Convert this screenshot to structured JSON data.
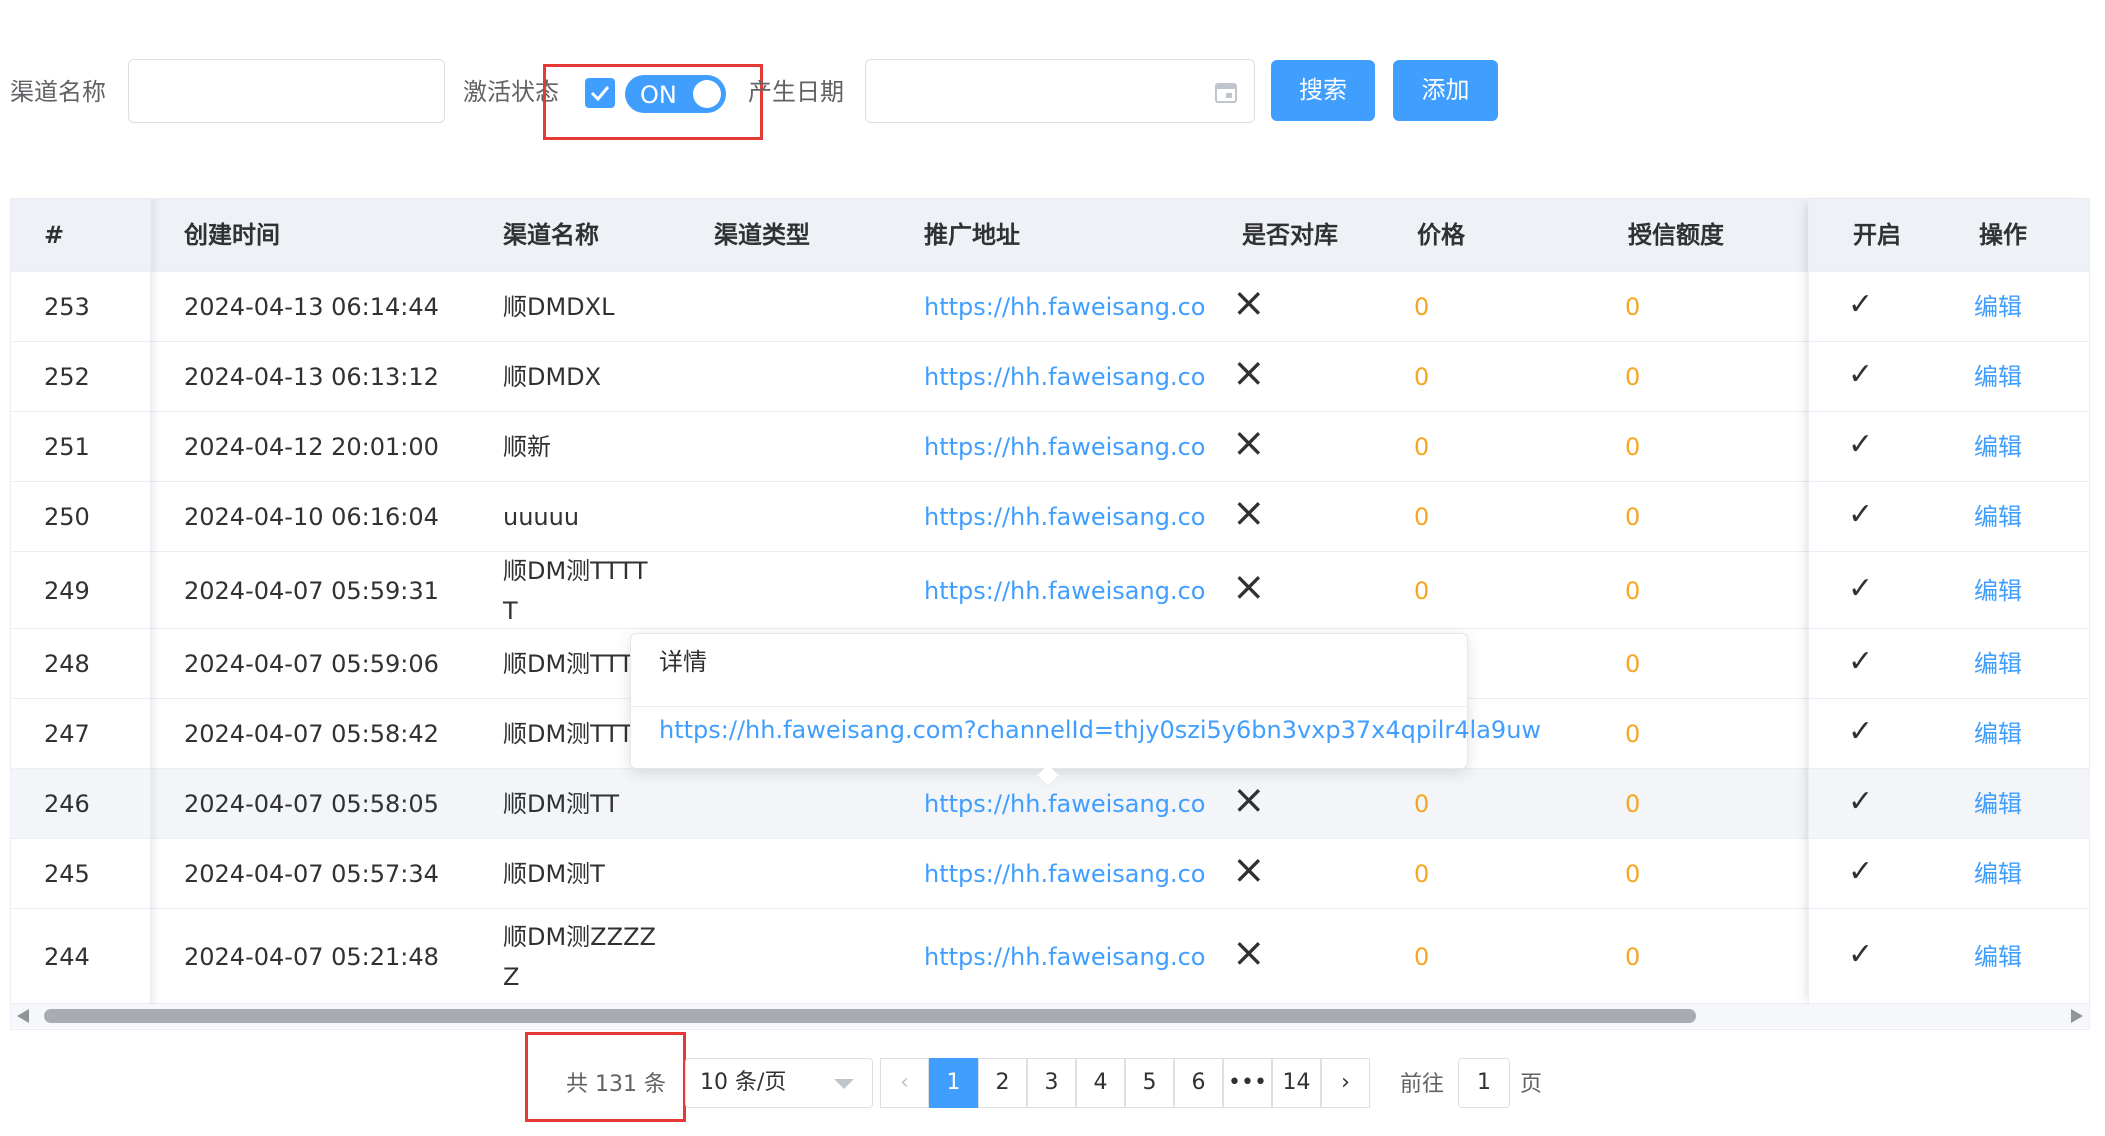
{
  "filters": {
    "channel_name_label": "渠道名称",
    "channel_name_value": "",
    "active_label": "激活状态",
    "active_checked": true,
    "switch_text": "ON",
    "date_label": "产生日期",
    "date_value": "",
    "calendar_icon": "calendar-icon",
    "search_label": "搜索",
    "add_label": "添加"
  },
  "table": {
    "headers": {
      "id": "#",
      "created": "创建时间",
      "name": "渠道名称",
      "type": "渠道类型",
      "url": "推广地址",
      "reconcile": "是否对库",
      "price": "价格",
      "credit": "授信额度",
      "enabled": "开启",
      "action": "操作"
    },
    "rows": [
      {
        "id": "253",
        "created": "2024-04-13 06:14:44",
        "name": "顺DMDXL",
        "name2": "",
        "type": "",
        "url": "https://hh.faweisang.co",
        "reconcile": "×",
        "price": "0",
        "credit": "0",
        "enabled": "✓",
        "action": "编辑"
      },
      {
        "id": "252",
        "created": "2024-04-13 06:13:12",
        "name": "顺DMDX",
        "name2": "",
        "type": "",
        "url": "https://hh.faweisang.co",
        "reconcile": "×",
        "price": "0",
        "credit": "0",
        "enabled": "✓",
        "action": "编辑"
      },
      {
        "id": "251",
        "created": "2024-04-12 20:01:00",
        "name": "顺新",
        "name2": "",
        "type": "",
        "url": "https://hh.faweisang.co",
        "reconcile": "×",
        "price": "0",
        "credit": "0",
        "enabled": "✓",
        "action": "编辑"
      },
      {
        "id": "250",
        "created": "2024-04-10 06:16:04",
        "name": "uuuuu",
        "name2": "",
        "type": "",
        "url": "https://hh.faweisang.co",
        "reconcile": "×",
        "price": "0",
        "credit": "0",
        "enabled": "✓",
        "action": "编辑"
      },
      {
        "id": "249",
        "created": "2024-04-07 05:59:31",
        "name": "顺DM测TTTT",
        "name2": "T",
        "type": "",
        "url": "https://hh.faweisang.co",
        "reconcile": "×",
        "price": "0",
        "credit": "0",
        "enabled": "✓",
        "action": "编辑"
      },
      {
        "id": "248",
        "created": "2024-04-07 05:59:06",
        "name": "顺DM测TTT",
        "name2": "",
        "type": "",
        "url": "",
        "reconcile": "",
        "price": "",
        "credit": "0",
        "enabled": "✓",
        "action": "编辑"
      },
      {
        "id": "247",
        "created": "2024-04-07 05:58:42",
        "name": "顺DM测TTT",
        "name2": "",
        "type": "",
        "url": "",
        "reconcile": "",
        "price": "",
        "credit": "0",
        "enabled": "✓",
        "action": "编辑"
      },
      {
        "id": "246",
        "created": "2024-04-07 05:58:05",
        "name": "顺DM测TT",
        "name2": "",
        "type": "",
        "url": "https://hh.faweisang.co",
        "reconcile": "×",
        "price": "0",
        "credit": "0",
        "enabled": "✓",
        "action": "编辑"
      },
      {
        "id": "245",
        "created": "2024-04-07 05:57:34",
        "name": "顺DM测T",
        "name2": "",
        "type": "",
        "url": "https://hh.faweisang.co",
        "reconcile": "×",
        "price": "0",
        "credit": "0",
        "enabled": "✓",
        "action": "编辑"
      },
      {
        "id": "244",
        "created": "2024-04-07 05:21:48",
        "name": "顺DM测ZZZZ",
        "name2": "Z",
        "type": "",
        "url": "https://hh.faweisang.co",
        "reconcile": "×",
        "price": "0",
        "credit": "0",
        "enabled": "✓",
        "action": "编辑"
      }
    ]
  },
  "popover": {
    "title": "详情",
    "link": "https://hh.faweisang.com?channelId=thjy0szi5y6bn3vxp37x4qpilr4la9uw"
  },
  "pagination": {
    "total": "共 131 条",
    "page_size": "10 条/页",
    "pages": [
      "1",
      "2",
      "3",
      "4",
      "5",
      "6",
      "•••",
      "14"
    ],
    "current": "1",
    "goto_label": "前往",
    "goto_value": "1",
    "page_suffix": "页"
  },
  "colors": {
    "accent": "#409eff",
    "number": "#f5a623",
    "highlight": "#e53935"
  }
}
